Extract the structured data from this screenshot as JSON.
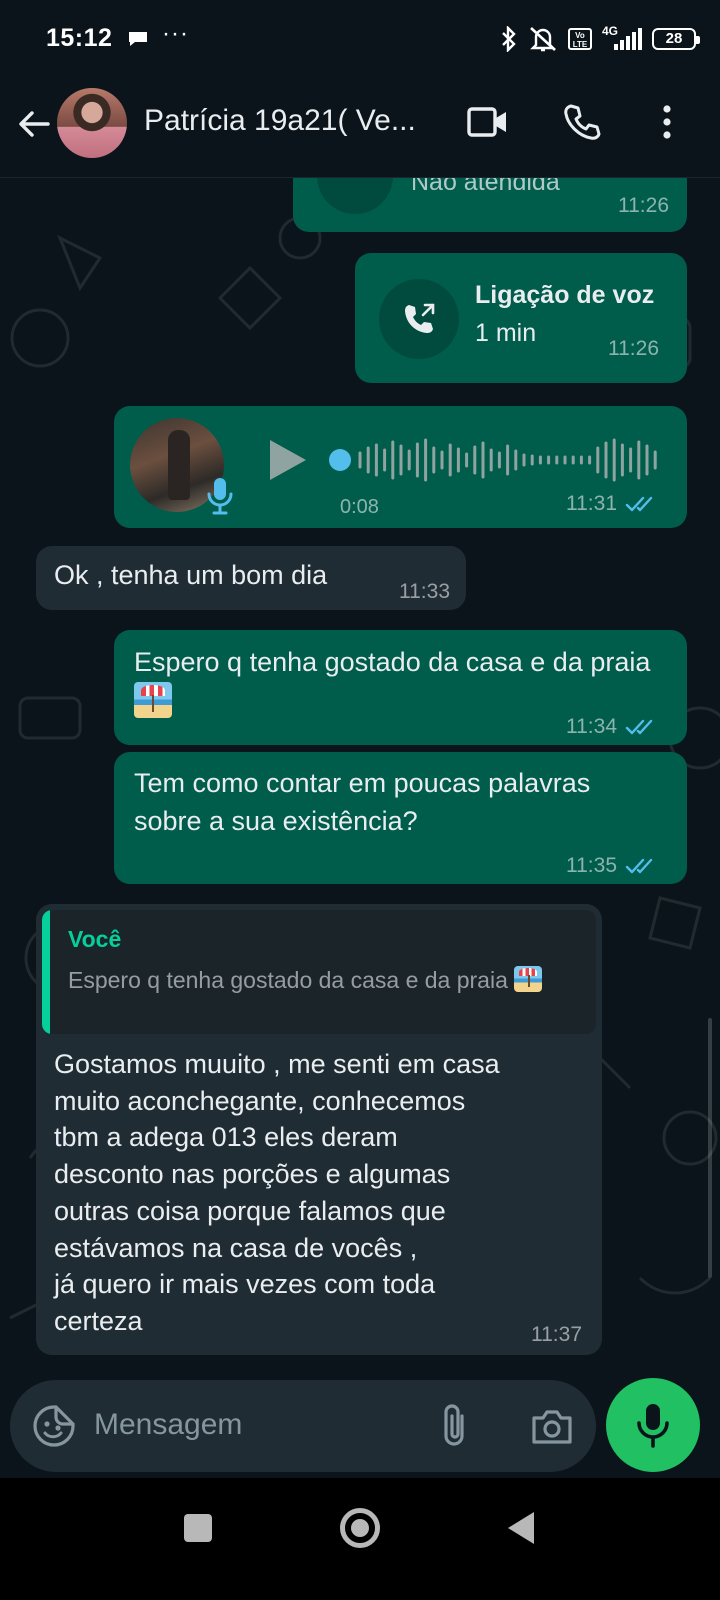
{
  "status_bar": {
    "time": "15:12",
    "dots": "···",
    "volte": "Vo LTE",
    "network": "4G",
    "battery": "28"
  },
  "header": {
    "contact_name": "Patrícia 19a21( Ve..."
  },
  "messages": {
    "missed_call": {
      "label": "Não atendida",
      "time": "11:26"
    },
    "voice_call": {
      "title": "Ligação de voz",
      "duration": "1 min",
      "time": "11:26"
    },
    "audio": {
      "duration": "0:08",
      "time": "11:31"
    },
    "ok": {
      "text": "Ok , tenha um bom dia",
      "time": "11:33"
    },
    "espero": {
      "text": "Espero q tenha gostado da casa e da praia",
      "time": "11:34"
    },
    "tem": {
      "text": "Tem como contar em poucas palavras sobre a sua existência?",
      "time": "11:35"
    },
    "reply": {
      "quote_author": "Você",
      "quote_text": "Espero q tenha gostado da casa e da praia",
      "text": "Gostamos muuito , me senti em casa\nmuito aconchegante, conhecemos\ntbm a adega 013 eles deram\ndesconto nas porções e algumas\noutras coisa porque falamos que\nestávamos na casa de vocês ,\njá quero ir mais vezes com toda\ncerteza",
      "time": "11:37"
    }
  },
  "composer": {
    "placeholder": "Mensagem"
  },
  "colors": {
    "background": "#0b141a",
    "outgoing_bubble": "#005c4b",
    "incoming_bubble": "#202c33",
    "accent_green": "#21c063",
    "read_ticks": "#53bdeb"
  }
}
